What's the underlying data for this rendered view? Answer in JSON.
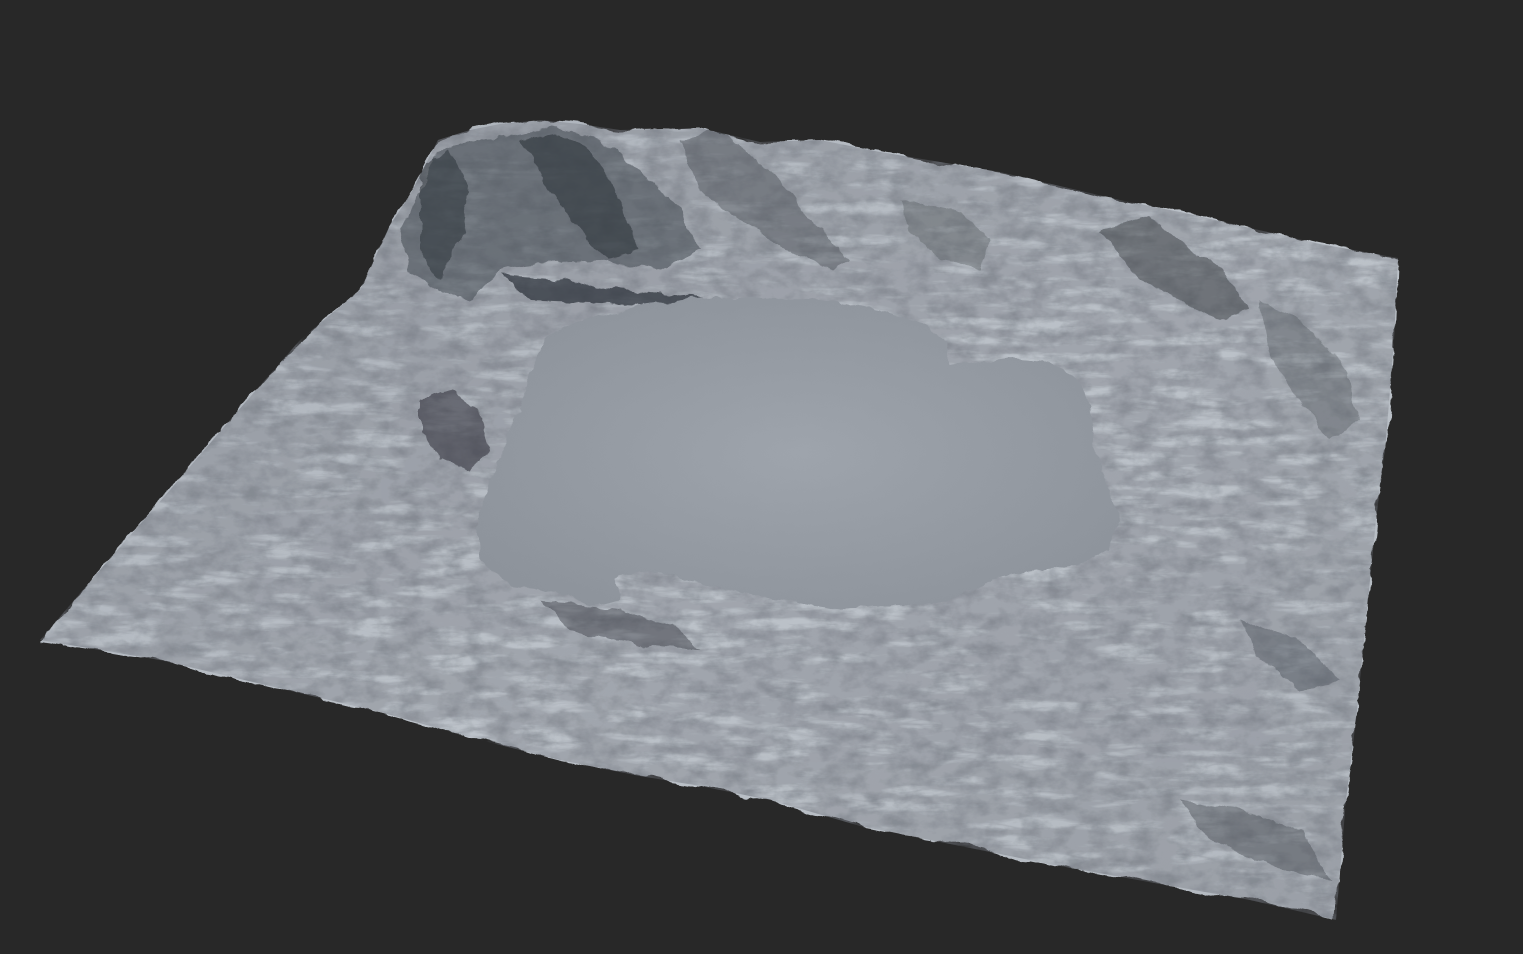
{
  "scene": {
    "background_color": "#282828",
    "subject": "terrain-heightmap-render",
    "colors": {
      "terrain_light": "#b9bfc6",
      "terrain_mid": "#8e949c",
      "terrain_dark": "#3a3e45",
      "lake": "#9aa0a8",
      "lake_edge": "#8a9098"
    }
  }
}
